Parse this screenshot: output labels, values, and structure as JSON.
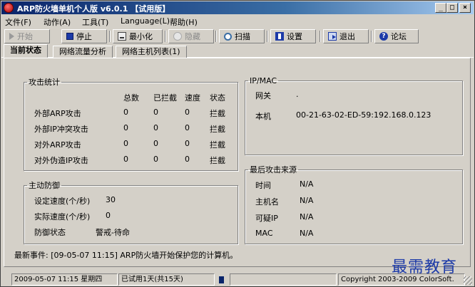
{
  "window": {
    "title": "ARP防火墙单机个人版 v6.0.1 【试用版】",
    "controls": {
      "minimize": "_",
      "maximize": "□",
      "close": "×"
    }
  },
  "menu": [
    "文件(F)",
    "动作(A)",
    "工具(T)",
    "Language(L)",
    "帮助(H)"
  ],
  "toolbar": {
    "start": {
      "label": "开始",
      "icon": "play-icon",
      "enabled": false
    },
    "stop": {
      "label": "停止",
      "icon": "stop-icon",
      "enabled": true
    },
    "minimize": {
      "label": "最小化",
      "icon": "minimize-icon",
      "enabled": true
    },
    "hide": {
      "label": "隐藏",
      "icon": "hide-icon",
      "enabled": false
    },
    "scan": {
      "label": "扫描",
      "icon": "scan-icon",
      "enabled": true
    },
    "settings": {
      "label": "设置",
      "icon": "settings-icon",
      "enabled": true
    },
    "exit": {
      "label": "退出",
      "icon": "exit-icon",
      "enabled": true
    },
    "forum": {
      "label": "论坛",
      "icon": "forum-icon",
      "enabled": true
    }
  },
  "tabs": [
    {
      "label": "当前状态",
      "active": true
    },
    {
      "label": "网络流量分析",
      "active": false
    },
    {
      "label": "网络主机列表(1)",
      "active": false
    }
  ],
  "attack_stats": {
    "legend": "攻击统计",
    "columns": [
      "总数",
      "已拦截",
      "速度",
      "状态"
    ],
    "rows": [
      {
        "label": "外部ARP攻击",
        "total": "0",
        "blocked": "0",
        "speed": "0",
        "status": "拦截"
      },
      {
        "label": "外部IP冲突攻击",
        "total": "0",
        "blocked": "0",
        "speed": "0",
        "status": "拦截"
      },
      {
        "label": "对外ARP攻击",
        "total": "0",
        "blocked": "0",
        "speed": "0",
        "status": "拦截"
      },
      {
        "label": "对外伪造IP攻击",
        "total": "0",
        "blocked": "0",
        "speed": "0",
        "status": "拦截"
      }
    ]
  },
  "ip_mac": {
    "legend": "IP/MAC",
    "gateway_label": "网关",
    "gateway_value": ".",
    "local_label": "本机",
    "local_value": "00-21-63-02-ED-59:192.168.0.123"
  },
  "active_defense": {
    "legend": "主动防御",
    "set_speed_label": "设定速度(个/秒)",
    "set_speed_value": "30",
    "actual_speed_label": "实际速度(个/秒)",
    "actual_speed_value": "0",
    "status_label": "防御状态",
    "status_value": "警戒-待命"
  },
  "last_attack": {
    "legend": "最后攻击来源",
    "time_label": "时间",
    "time_value": "N/A",
    "host_label": "主机名",
    "host_value": "N/A",
    "ip_label": "可疑IP",
    "ip_value": "N/A",
    "mac_label": "MAC",
    "mac_value": "N/A"
  },
  "latest_event": "最新事件: [09-05-07 11:15] ARP防火墙开始保护您的计算机。",
  "watermark": "最需教育",
  "statusbar": {
    "datetime": "2009-05-07 11:15 星期四",
    "trial": "已试用1天(共15天)",
    "copyright": "Copyright 2003-2009 ColorSoft."
  },
  "colors": {
    "title_start": "#0a246a",
    "title_end": "#a6caf0",
    "face": "#d4d0c8",
    "watermark": "#1c3aa8"
  }
}
